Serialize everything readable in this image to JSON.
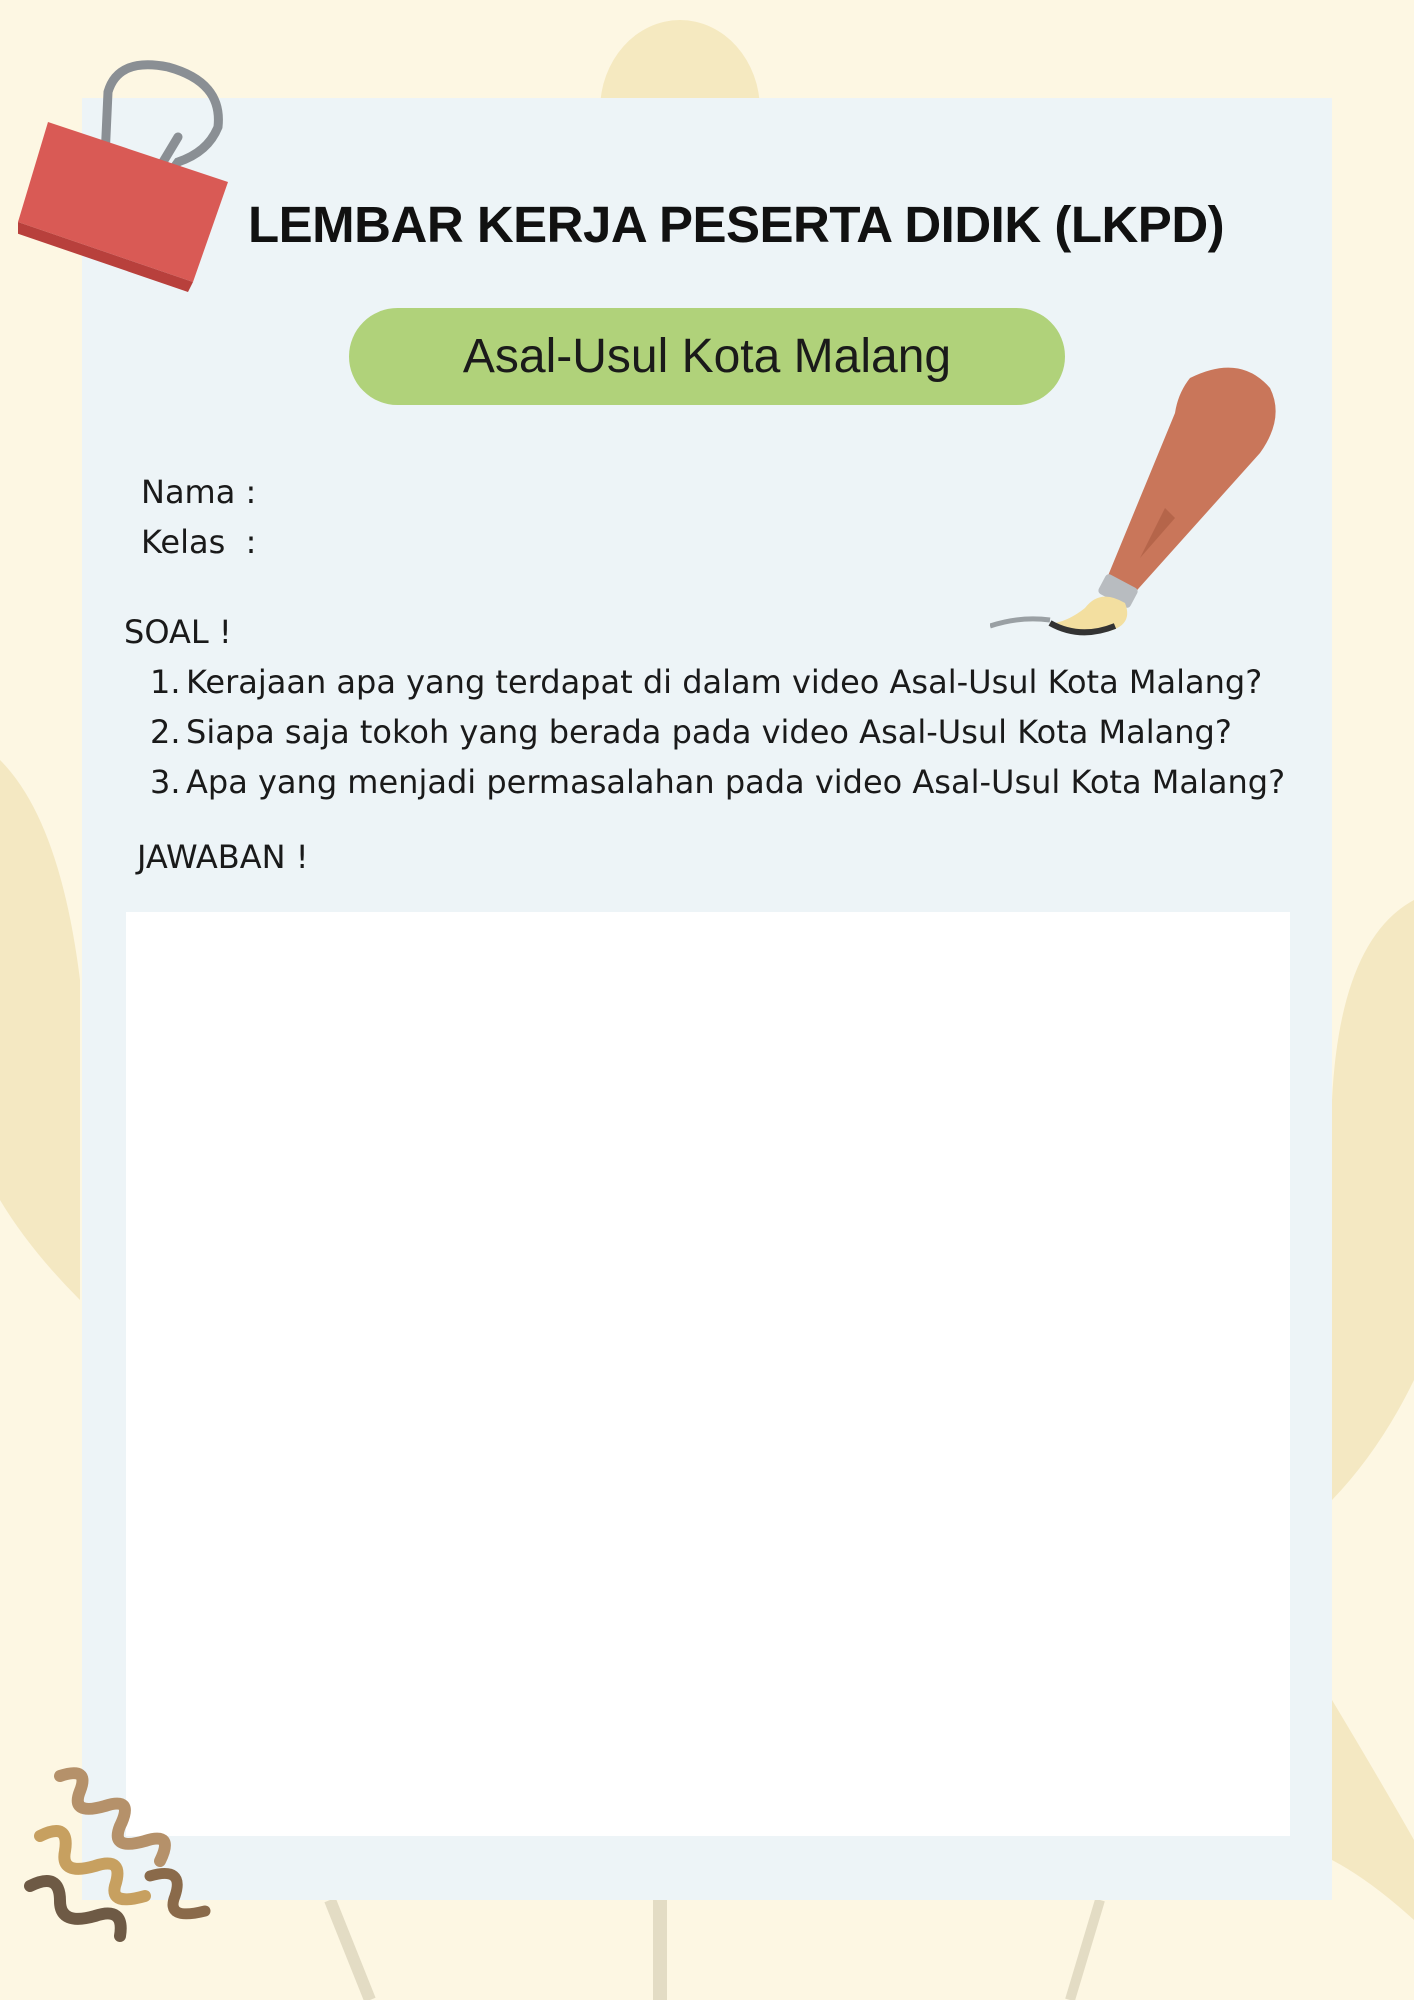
{
  "header": {
    "title": "LEMBAR KERJA PESERTA DIDIK (LKPD)",
    "subtitle": "Asal-Usul Kota Malang"
  },
  "fields": [
    {
      "label": "Nama :"
    },
    {
      "label": "Kelas  :"
    }
  ],
  "soal": {
    "heading": "SOAL !",
    "questions": [
      {
        "num": "1.",
        "text": "Kerajaan apa yang terdapat di dalam video Asal-Usul Kota Malang?"
      },
      {
        "num": "2.",
        "text": "Siapa saja tokoh yang berada pada video Asal-Usul Kota Malang?"
      },
      {
        "num": "3.",
        "text": "Apa yang menjadi permasalahan pada video Asal-Usul Kota Malang?"
      }
    ]
  },
  "jawaban": {
    "heading": "JAWABAN !"
  },
  "colors": {
    "background": "#fdf7e3",
    "card": "#edf4f7",
    "pill": "#b0d27a",
    "answer_box": "#ffffff"
  },
  "icons": [
    "binder-clip-icon",
    "paintbrush-icon",
    "squiggle-decoration-icon"
  ]
}
